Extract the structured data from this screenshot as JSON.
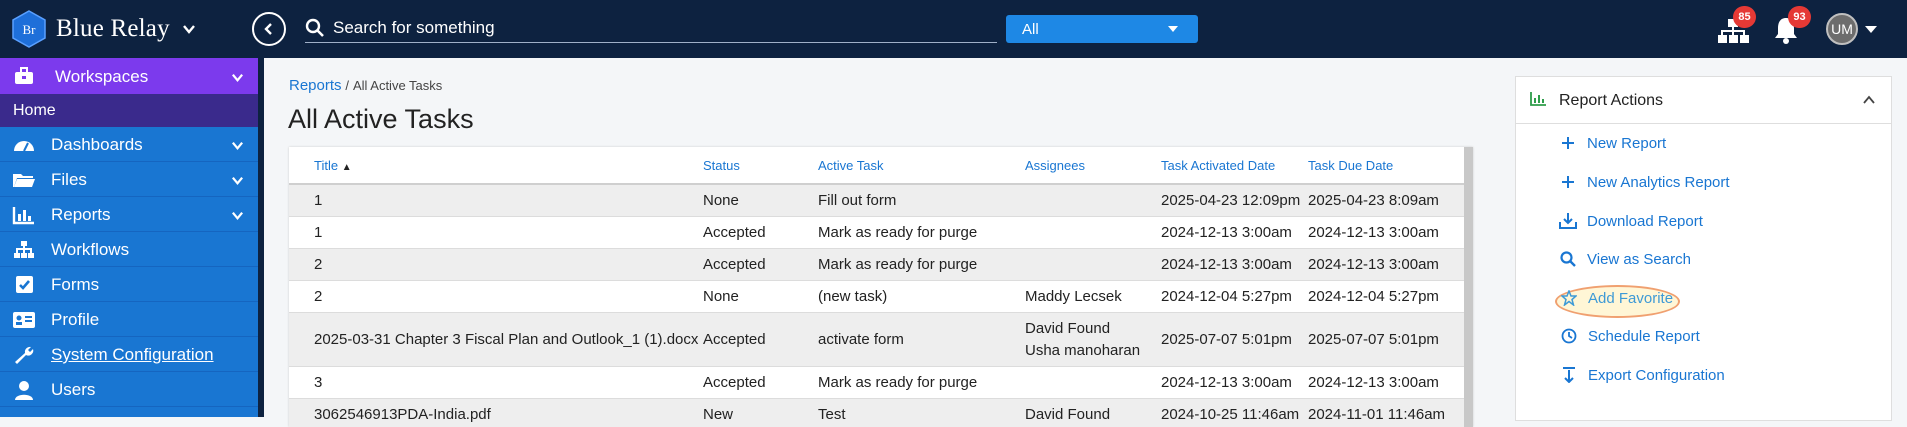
{
  "app": {
    "brand_name": "Blue Relay",
    "brand_logo_text": "Br"
  },
  "topbar": {
    "search_placeholder": "Search for something",
    "scope_value": "All",
    "org_badge": "85",
    "notifications_badge": "93",
    "avatar_initials": "UM"
  },
  "sidebar": {
    "workspaces_label": "Workspaces",
    "home_label": "Home",
    "items": [
      {
        "label": "Dashboards",
        "icon": "dashboard-icon",
        "expandable": true
      },
      {
        "label": "Files",
        "icon": "folder-icon",
        "expandable": true
      },
      {
        "label": "Reports",
        "icon": "chart-icon",
        "expandable": true
      },
      {
        "label": "Workflows",
        "icon": "sitemap-icon",
        "expandable": false
      },
      {
        "label": "Forms",
        "icon": "checkbox-icon",
        "expandable": false
      },
      {
        "label": "Profile",
        "icon": "id-card-icon",
        "expandable": false
      },
      {
        "label": "System Configuration",
        "icon": "wrench-icon",
        "expandable": false
      },
      {
        "label": "Users",
        "icon": "user-icon",
        "expandable": false
      }
    ]
  },
  "breadcrumb": {
    "parent": "Reports",
    "separator": "/",
    "current": "All Active Tasks"
  },
  "page_title": "All Active Tasks",
  "table": {
    "columns": [
      "Title",
      "Status",
      "Active Task",
      "Assignees",
      "Task Activated Date",
      "Task Due Date"
    ],
    "sort_indicator": "▲",
    "rows": [
      {
        "title": "1",
        "status": "None",
        "active_task": "Fill out form",
        "assignees": "",
        "assignees2": "",
        "activated": "2025-04-23 12:09pm",
        "due": "2025-04-23 8:09am"
      },
      {
        "title": "1",
        "status": "Accepted",
        "active_task": "Mark as ready for purge",
        "assignees": "",
        "assignees2": "",
        "activated": "2024-12-13 3:00am",
        "due": "2024-12-13 3:00am"
      },
      {
        "title": "2",
        "status": "Accepted",
        "active_task": "Mark as ready for purge",
        "assignees": "",
        "assignees2": "",
        "activated": "2024-12-13 3:00am",
        "due": "2024-12-13 3:00am"
      },
      {
        "title": "2",
        "status": "None",
        "active_task": "(new task)",
        "assignees": "Maddy Lecsek",
        "assignees2": "",
        "activated": "2024-12-04 5:27pm",
        "due": "2024-12-04 5:27pm"
      },
      {
        "title": "2025-03-31 Chapter 3 Fiscal Plan and Outlook_1 (1).docx",
        "status": "Accepted",
        "active_task": "activate form",
        "assignees": "David Found",
        "assignees2": "Usha manoharan",
        "activated": "2025-07-07 5:01pm",
        "due": "2025-07-07 5:01pm"
      },
      {
        "title": "3",
        "status": "Accepted",
        "active_task": "Mark as ready for purge",
        "assignees": "",
        "assignees2": "",
        "activated": "2024-12-13 3:00am",
        "due": "2024-12-13 3:00am"
      },
      {
        "title": "3062546913PDA-India.pdf",
        "status": "New",
        "active_task": "Test",
        "assignees": "David Found",
        "assignees2": "",
        "activated": "2024-10-25 11:46am",
        "due": "2024-11-01 11:46am"
      }
    ]
  },
  "panel": {
    "title": "Report Actions",
    "actions": [
      {
        "label": "New Report",
        "icon": "plus-icon"
      },
      {
        "label": "New Analytics Report",
        "icon": "plus-icon"
      },
      {
        "label": "Download Report",
        "icon": "download-icon"
      },
      {
        "label": "View as Search",
        "icon": "search-icon"
      },
      {
        "label": "Add Favorite",
        "icon": "star-icon"
      },
      {
        "label": "Schedule Report",
        "icon": "clock-icon"
      },
      {
        "label": "Export Configuration",
        "icon": "export-icon"
      }
    ]
  },
  "colors": {
    "topbar": "#0d2240",
    "sidebar": "#1976d2",
    "workspaces": "#7c3aed",
    "accent": "#1976d2",
    "badge": "#e53935"
  }
}
